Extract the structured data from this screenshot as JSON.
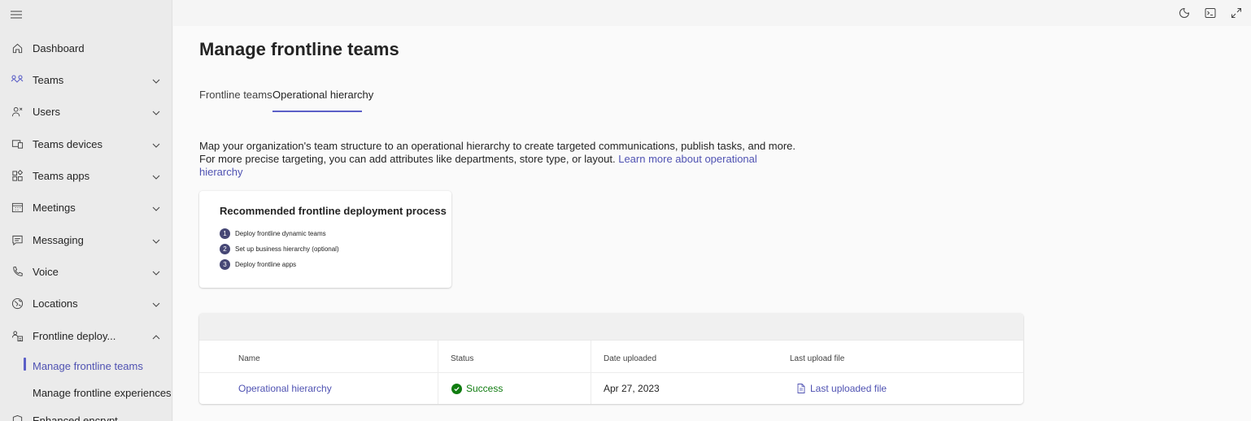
{
  "sidebar": {
    "items": [
      {
        "label": "Dashboard",
        "icon": "home-icon"
      },
      {
        "label": "Teams",
        "icon": "teams-icon"
      },
      {
        "label": "Users",
        "icon": "users-icon"
      },
      {
        "label": "Teams devices",
        "icon": "devices-icon"
      },
      {
        "label": "Teams apps",
        "icon": "apps-icon"
      },
      {
        "label": "Meetings",
        "icon": "calendar-icon"
      },
      {
        "label": "Messaging",
        "icon": "chat-icon"
      },
      {
        "label": "Voice",
        "icon": "phone-icon"
      },
      {
        "label": "Locations",
        "icon": "globe-icon"
      },
      {
        "label": "Frontline deploy...",
        "icon": "frontline-icon"
      },
      {
        "label": "Enhanced encrypt...",
        "icon": "shield-icon"
      }
    ],
    "subitems": [
      {
        "label": "Manage frontline teams",
        "active": true
      },
      {
        "label": "Manage frontline experiences",
        "active": false
      }
    ]
  },
  "topbar": {
    "icons": [
      "dark-mode-icon",
      "terminal-icon",
      "expand-icon"
    ]
  },
  "main": {
    "title": "Manage frontline teams",
    "tabs": [
      {
        "label": "Frontline teams",
        "active": false
      },
      {
        "label": "Operational hierarchy",
        "active": true
      }
    ],
    "description": "Map your organization's team structure to an operational hierarchy to create targeted communications, publish tasks, and more. For more precise targeting, you can add attributes like departments, store type, or layout.",
    "learn_more": "Learn more about operational hierarchy",
    "card": {
      "title": "Recommended frontline deployment process",
      "steps": [
        {
          "num": "1",
          "text": "Deploy frontline dynamic teams"
        },
        {
          "num": "2",
          "text": "Set up business hierarchy (optional)"
        },
        {
          "num": "3",
          "text": "Deploy frontline apps"
        }
      ]
    },
    "table": {
      "headers": [
        "Name",
        "Status",
        "Date uploaded",
        "Last upload file"
      ],
      "rows": [
        {
          "name": "Operational hierarchy",
          "status": "Success",
          "date": "Apr 27, 2023",
          "file": "Last uploaded file"
        }
      ]
    }
  },
  "colors": {
    "accent": "#5b5fc7",
    "link": "#4f52b2",
    "success": "#107c10",
    "step_badge": "#464775"
  }
}
